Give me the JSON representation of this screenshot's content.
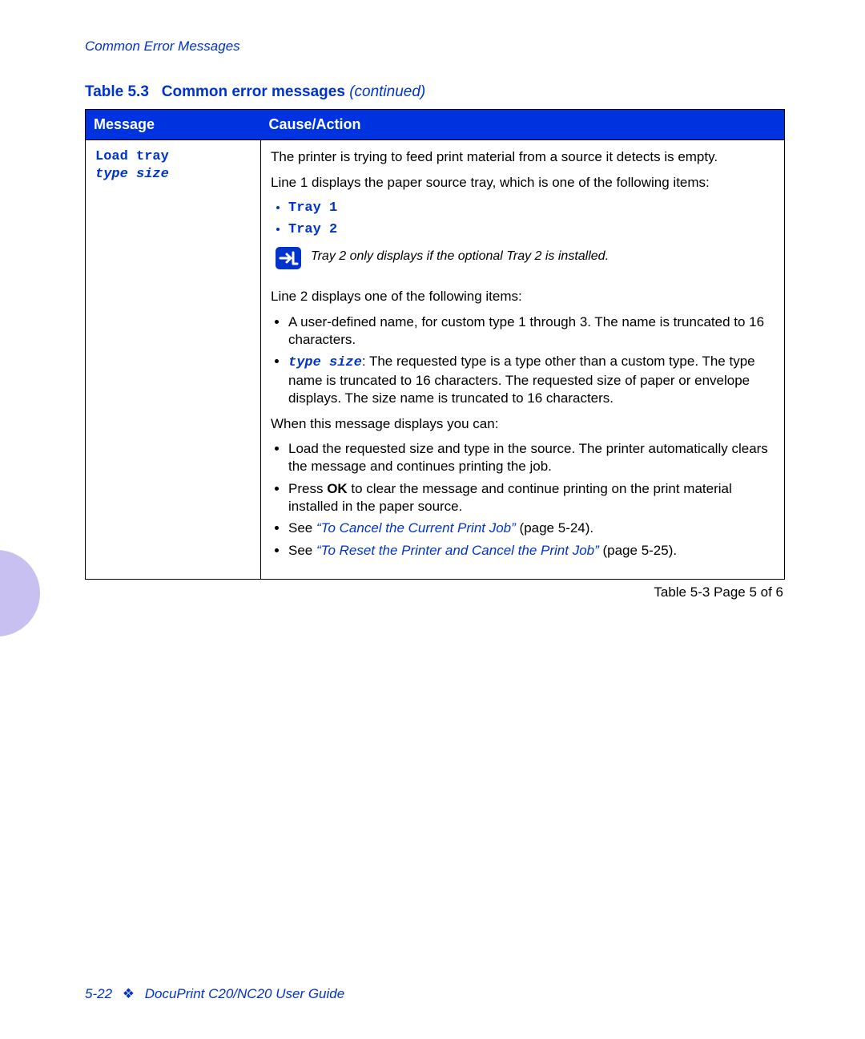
{
  "section_header": "Common Error Messages",
  "table_title_prefix": "Table 5.3",
  "table_title_main": "Common error messages",
  "table_title_suffix": "(continued)",
  "headers": {
    "message": "Message",
    "cause_action": "Cause/Action"
  },
  "row": {
    "message_line1": "Load tray",
    "message_line2": "type size",
    "p1": "The printer is trying to feed print material from a source it detects is empty.",
    "p2": "Line 1 displays the paper source tray, which is one of the following items:",
    "trays": [
      "Tray 1",
      "Tray 2"
    ],
    "note": "Tray 2 only displays if the optional Tray 2 is installed.",
    "p3": "Line 2 displays one of the following items:",
    "li3a": "A user-defined name, for custom type 1 through 3. The name is truncated to 16 characters.",
    "li3b_prefix": "type size",
    "li3b_rest": ": The requested type is a type other than a custom type. The type name is truncated to 16 characters. The requested size of paper or envelope displays. The size name is truncated to 16 characters.",
    "p4": "When this message displays you can:",
    "li4a": "Load the requested size and type in the source. The printer automatically clears the message and continues printing the job.",
    "li4b_pre": "Press ",
    "li4b_bold": "OK",
    "li4b_post": " to clear the message and continue printing on the print material installed in the paper source.",
    "li4c_pre": "See ",
    "li4c_link": "“To Cancel the Current Print Job”",
    "li4c_post": " (page 5-24).",
    "li4d_pre": "See ",
    "li4d_link": "“To Reset the Printer and Cancel the Print Job”",
    "li4d_post": " (page 5-25)."
  },
  "table_pager": "Table 5-3  Page 5 of 6",
  "footer": {
    "page_num": "5-22",
    "guide": "DocuPrint C20/NC20 User Guide"
  }
}
